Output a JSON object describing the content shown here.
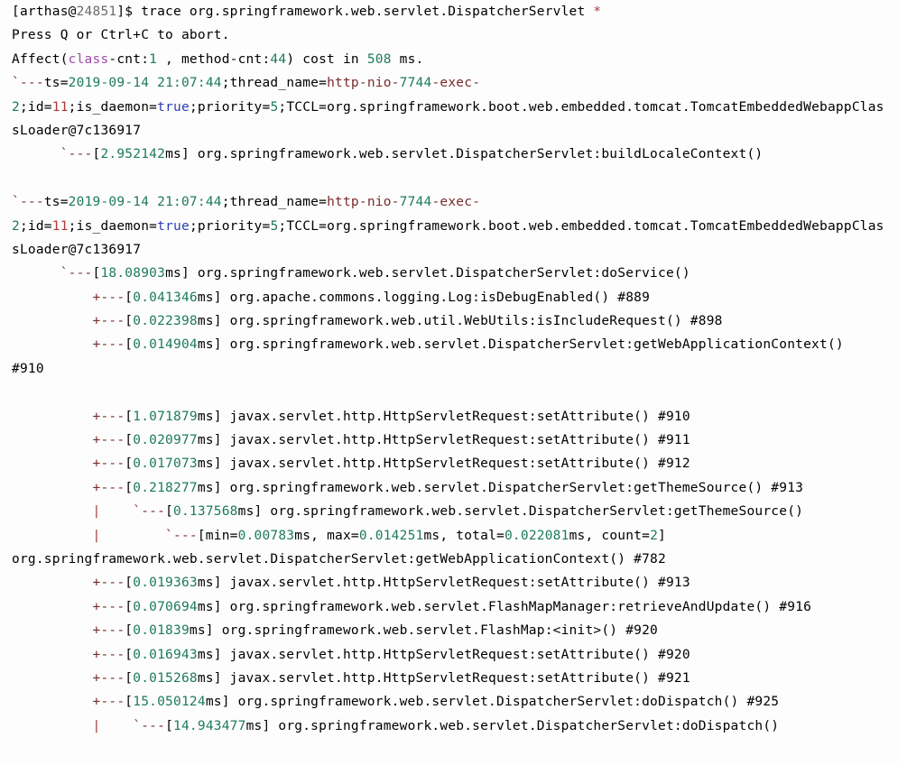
{
  "terminal": {
    "title": "arthas-trace-output",
    "background_color": "#fdfdfd",
    "foreground_color": "#000000",
    "colors": {
      "green": "#1d7a5e",
      "red": "#b03a3a",
      "blue": "#2b3fb5",
      "purple": "#a04ba8",
      "gray": "#6b6b6b",
      "maroon": "#7a2b2b"
    },
    "prompt": {
      "bracket_open": "[",
      "user": "arthas",
      "at": "@",
      "pid": "24851",
      "bracket_close": "]",
      "sigil": "$",
      "command": " trace org.springframework.web.servlet.DispatcherServlet ",
      "wildcard": "*"
    },
    "lines": [
      {
        "id": "line-prompt",
        "segments": [
          {
            "text": "[arthas@",
            "color": "black"
          },
          {
            "text": "24851",
            "color": "gray"
          },
          {
            "text": "]$ trace org.springframework.web.servlet.DispatcherServlet ",
            "color": "black"
          },
          {
            "text": "*",
            "color": "red"
          }
        ]
      },
      {
        "id": "line-abort-hint",
        "segments": [
          {
            "text": "Press Q or Ctrl+C to abort.",
            "color": "black"
          }
        ]
      },
      {
        "id": "line-affect",
        "segments": [
          {
            "text": "Affect(",
            "color": "black"
          },
          {
            "text": "class",
            "color": "purple"
          },
          {
            "text": "-cnt:",
            "color": "black"
          },
          {
            "text": "1",
            "color": "green"
          },
          {
            "text": " , method-cnt:",
            "color": "black"
          },
          {
            "text": "44",
            "color": "green"
          },
          {
            "text": ") cost in ",
            "color": "black"
          },
          {
            "text": "508",
            "color": "green"
          },
          {
            "text": " ms.",
            "color": "black"
          }
        ]
      },
      {
        "id": "line-ts-1",
        "segments": [
          {
            "text": "`---",
            "color": "maroon"
          },
          {
            "text": "ts=",
            "color": "black"
          },
          {
            "text": "2019-09-14 21:07:44",
            "color": "green"
          },
          {
            "text": ";thread_name=",
            "color": "black"
          },
          {
            "text": "http-nio-",
            "color": "maroon"
          },
          {
            "text": "7744",
            "color": "green"
          },
          {
            "text": "-exec-",
            "color": "maroon"
          }
        ]
      },
      {
        "id": "line-ts-1-wrap-a",
        "segments": [
          {
            "text": "2",
            "color": "green"
          },
          {
            "text": ";id=",
            "color": "black"
          },
          {
            "text": "11",
            "color": "red"
          },
          {
            "text": ";is_daemon=",
            "color": "black"
          },
          {
            "text": "true",
            "color": "blue"
          },
          {
            "text": ";priority=",
            "color": "black"
          },
          {
            "text": "5",
            "color": "green"
          },
          {
            "text": ";TCCL=org.springframework.boot.web.embedded.tomcat.TomcatEmbeddedWebappClas",
            "color": "black"
          }
        ]
      },
      {
        "id": "line-ts-1-wrap-b",
        "segments": [
          {
            "text": "sLoader@7c136917",
            "color": "black"
          }
        ]
      },
      {
        "id": "line-buildlocalecontext",
        "segments": [
          {
            "text": "      `---",
            "color": "maroon"
          },
          {
            "text": "[",
            "color": "black"
          },
          {
            "text": "2.952142",
            "color": "green"
          },
          {
            "text": "ms] org.springframework.web.servlet.DispatcherServlet:buildLocaleContext()",
            "color": "black"
          }
        ]
      },
      {
        "id": "line-blank-1",
        "segments": [
          {
            "text": " ",
            "color": "black"
          }
        ]
      },
      {
        "id": "line-ts-2",
        "segments": [
          {
            "text": "`---",
            "color": "maroon"
          },
          {
            "text": "ts=",
            "color": "black"
          },
          {
            "text": "2019-09-14 21:07:44",
            "color": "green"
          },
          {
            "text": ";thread_name=",
            "color": "black"
          },
          {
            "text": "http-nio-",
            "color": "maroon"
          },
          {
            "text": "7744",
            "color": "green"
          },
          {
            "text": "-exec-",
            "color": "maroon"
          }
        ]
      },
      {
        "id": "line-ts-2-wrap-a",
        "segments": [
          {
            "text": "2",
            "color": "green"
          },
          {
            "text": ";id=",
            "color": "black"
          },
          {
            "text": "11",
            "color": "red"
          },
          {
            "text": ";is_daemon=",
            "color": "black"
          },
          {
            "text": "true",
            "color": "blue"
          },
          {
            "text": ";priority=",
            "color": "black"
          },
          {
            "text": "5",
            "color": "green"
          },
          {
            "text": ";TCCL=org.springframework.boot.web.embedded.tomcat.TomcatEmbeddedWebappClas",
            "color": "black"
          }
        ]
      },
      {
        "id": "line-ts-2-wrap-b",
        "segments": [
          {
            "text": "sLoader@7c136917",
            "color": "black"
          }
        ]
      },
      {
        "id": "line-doservice",
        "segments": [
          {
            "text": "      `---",
            "color": "maroon"
          },
          {
            "text": "[",
            "color": "black"
          },
          {
            "text": "18.08903",
            "color": "green"
          },
          {
            "text": "ms] org.springframework.web.servlet.DispatcherServlet:doService()",
            "color": "black"
          }
        ]
      },
      {
        "id": "line-isdebugenabled",
        "segments": [
          {
            "text": "          +---",
            "color": "maroon"
          },
          {
            "text": "[",
            "color": "black"
          },
          {
            "text": "0.041346",
            "color": "green"
          },
          {
            "text": "ms] org.apache.commons.logging.Log:isDebugEnabled() #889",
            "color": "black"
          }
        ]
      },
      {
        "id": "line-isincluderequest",
        "segments": [
          {
            "text": "          +---",
            "color": "maroon"
          },
          {
            "text": "[",
            "color": "black"
          },
          {
            "text": "0.022398",
            "color": "green"
          },
          {
            "text": "ms] org.springframework.web.util.WebUtils:isIncludeRequest() #898",
            "color": "black"
          }
        ]
      },
      {
        "id": "line-getwebappcontext-1",
        "segments": [
          {
            "text": "          +---",
            "color": "maroon"
          },
          {
            "text": "[",
            "color": "black"
          },
          {
            "text": "0.014904",
            "color": "green"
          },
          {
            "text": "ms] org.springframework.web.servlet.DispatcherServlet:getWebApplicationContext()",
            "color": "black"
          }
        ]
      },
      {
        "id": "line-getwebappcontext-1-wrap",
        "segments": [
          {
            "text": "#910",
            "color": "black"
          }
        ]
      },
      {
        "id": "line-blank-2",
        "segments": [
          {
            "text": " ",
            "color": "black"
          }
        ]
      },
      {
        "id": "line-setattribute-910a",
        "segments": [
          {
            "text": "          +---",
            "color": "maroon"
          },
          {
            "text": "[",
            "color": "black"
          },
          {
            "text": "1.071879",
            "color": "green"
          },
          {
            "text": "ms] javax.servlet.http.HttpServletRequest:setAttribute() #910",
            "color": "black"
          }
        ]
      },
      {
        "id": "line-setattribute-911",
        "segments": [
          {
            "text": "          +---",
            "color": "maroon"
          },
          {
            "text": "[",
            "color": "black"
          },
          {
            "text": "0.020977",
            "color": "green"
          },
          {
            "text": "ms] javax.servlet.http.HttpServletRequest:setAttribute() #911",
            "color": "black"
          }
        ]
      },
      {
        "id": "line-setattribute-912",
        "segments": [
          {
            "text": "          +---",
            "color": "maroon"
          },
          {
            "text": "[",
            "color": "black"
          },
          {
            "text": "0.017073",
            "color": "green"
          },
          {
            "text": "ms] javax.servlet.http.HttpServletRequest:setAttribute() #912",
            "color": "black"
          }
        ]
      },
      {
        "id": "line-getthemesource-913",
        "segments": [
          {
            "text": "          +---",
            "color": "maroon"
          },
          {
            "text": "[",
            "color": "black"
          },
          {
            "text": "0.218277",
            "color": "green"
          },
          {
            "text": "ms] org.springframework.web.servlet.DispatcherServlet:getThemeSource() #913",
            "color": "black"
          }
        ]
      },
      {
        "id": "line-getthemesource-nested",
        "segments": [
          {
            "text": "          |",
            "color": "bar"
          },
          {
            "text": "    `---",
            "color": "maroon"
          },
          {
            "text": "[",
            "color": "black"
          },
          {
            "text": "0.137568",
            "color": "green"
          },
          {
            "text": "ms] org.springframework.web.servlet.DispatcherServlet:getThemeSource()",
            "color": "black"
          }
        ]
      },
      {
        "id": "line-minmax-stats",
        "segments": [
          {
            "text": "          |",
            "color": "bar"
          },
          {
            "text": "        `---",
            "color": "maroon"
          },
          {
            "text": "[min=",
            "color": "black"
          },
          {
            "text": "0.00783",
            "color": "green"
          },
          {
            "text": "ms, max=",
            "color": "black"
          },
          {
            "text": "0.014251",
            "color": "green"
          },
          {
            "text": "ms, total=",
            "color": "black"
          },
          {
            "text": "0.022081",
            "color": "green"
          },
          {
            "text": "ms, count=",
            "color": "black"
          },
          {
            "text": "2",
            "color": "green"
          },
          {
            "text": "]",
            "color": "black"
          }
        ]
      },
      {
        "id": "line-getwebappcontext-782-wrap",
        "segments": [
          {
            "text": "org.springframework.web.servlet.DispatcherServlet:getWebApplicationContext() #782",
            "color": "black"
          }
        ]
      },
      {
        "id": "line-setattribute-913",
        "segments": [
          {
            "text": "          +---",
            "color": "maroon"
          },
          {
            "text": "[",
            "color": "black"
          },
          {
            "text": "0.019363",
            "color": "green"
          },
          {
            "text": "ms] javax.servlet.http.HttpServletRequest:setAttribute() #913",
            "color": "black"
          }
        ]
      },
      {
        "id": "line-retrieveandupdate-916",
        "segments": [
          {
            "text": "          +---",
            "color": "maroon"
          },
          {
            "text": "[",
            "color": "black"
          },
          {
            "text": "0.070694",
            "color": "green"
          },
          {
            "text": "ms] org.springframework.web.servlet.FlashMapManager:retrieveAndUpdate() #916",
            "color": "black"
          }
        ]
      },
      {
        "id": "line-flashmap-init-920",
        "segments": [
          {
            "text": "          +---",
            "color": "maroon"
          },
          {
            "text": "[",
            "color": "black"
          },
          {
            "text": "0.01839",
            "color": "green"
          },
          {
            "text": "ms] org.springframework.web.servlet.FlashMap:<init>() #920",
            "color": "black"
          }
        ]
      },
      {
        "id": "line-setattribute-920",
        "segments": [
          {
            "text": "          +---",
            "color": "maroon"
          },
          {
            "text": "[",
            "color": "black"
          },
          {
            "text": "0.016943",
            "color": "green"
          },
          {
            "text": "ms] javax.servlet.http.HttpServletRequest:setAttribute() #920",
            "color": "black"
          }
        ]
      },
      {
        "id": "line-setattribute-921",
        "segments": [
          {
            "text": "          +---",
            "color": "maroon"
          },
          {
            "text": "[",
            "color": "black"
          },
          {
            "text": "0.015268",
            "color": "green"
          },
          {
            "text": "ms] javax.servlet.http.HttpServletRequest:setAttribute() #921",
            "color": "black"
          }
        ]
      },
      {
        "id": "line-dodispatch-925",
        "segments": [
          {
            "text": "          +---",
            "color": "maroon"
          },
          {
            "text": "[",
            "color": "black"
          },
          {
            "text": "15.050124",
            "color": "green"
          },
          {
            "text": "ms] org.springframework.web.servlet.DispatcherServlet:doDispatch() #925",
            "color": "black"
          }
        ]
      },
      {
        "id": "line-dodispatch-nested",
        "segments": [
          {
            "text": "          |",
            "color": "bar"
          },
          {
            "text": "    `---",
            "color": "maroon"
          },
          {
            "text": "[",
            "color": "black"
          },
          {
            "text": "14.943477",
            "color": "green"
          },
          {
            "text": "ms] org.springframework.web.servlet.DispatcherServlet:doDispatch()",
            "color": "black"
          }
        ]
      }
    ]
  }
}
